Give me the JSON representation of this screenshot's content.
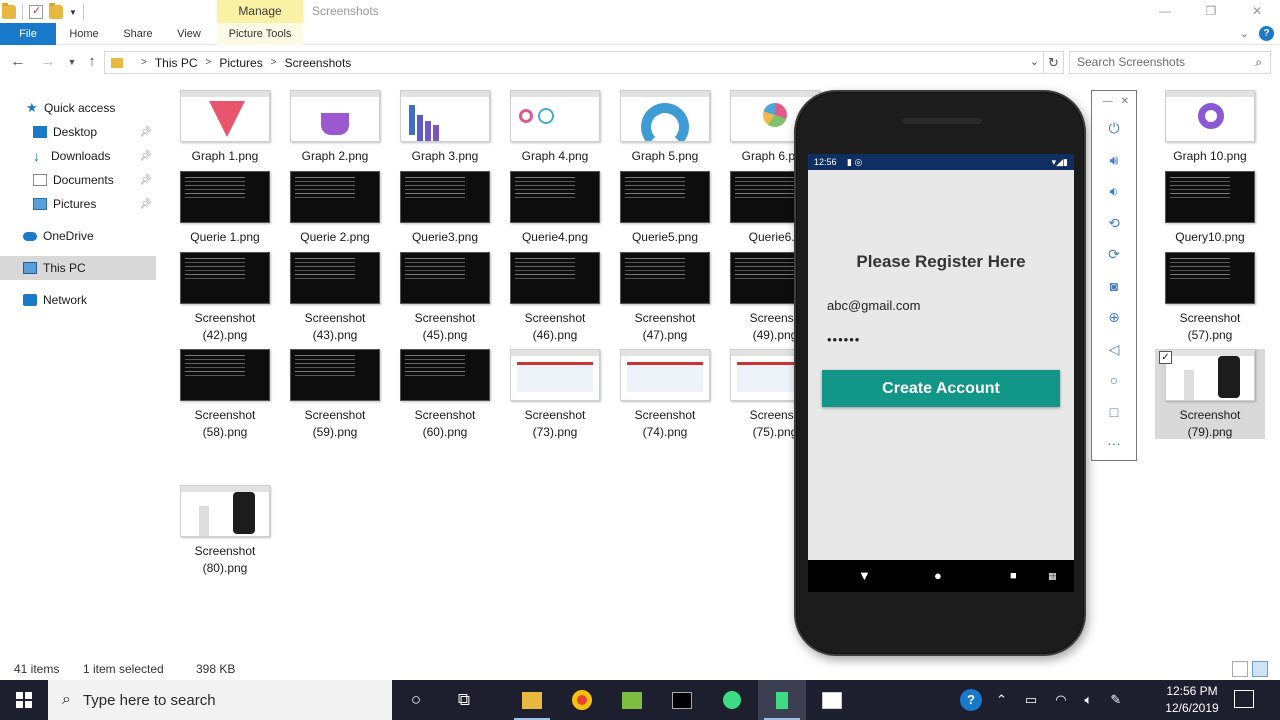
{
  "window": {
    "title": "Screenshots",
    "contextual_tab": "Manage",
    "controls": {
      "minimize": "—",
      "restore": "❐",
      "close": "✕"
    }
  },
  "ribbon": {
    "tabs": [
      "File",
      "Home",
      "Share",
      "View",
      "Picture Tools"
    ],
    "help": "?"
  },
  "address": {
    "breadcrumbs": [
      "This PC",
      "Pictures",
      "Screenshots"
    ],
    "search_placeholder": "Search Screenshots"
  },
  "nav": {
    "items": [
      "Quick access",
      "Desktop",
      "Downloads",
      "Documents",
      "Pictures",
      "OneDrive",
      "This PC",
      "Network"
    ],
    "selected": "This PC"
  },
  "files": [
    {
      "name": "Graph 1.png",
      "thumb": "funnel"
    },
    {
      "name": "Graph 2.png",
      "thumb": "cup"
    },
    {
      "name": "Graph 3.png",
      "thumb": "bars"
    },
    {
      "name": "Graph 4.png",
      "thumb": "rings"
    },
    {
      "name": "Graph 5.png",
      "thumb": "gauge"
    },
    {
      "name": "Graph 6.png",
      "thumb": "pie"
    },
    {
      "name": "Graph 10.png",
      "thumb": "donut"
    },
    {
      "name": "Querie 1.png",
      "thumb": "console"
    },
    {
      "name": "Querie 2.png",
      "thumb": "console"
    },
    {
      "name": "Querie3.png",
      "thumb": "console"
    },
    {
      "name": "Querie4.png",
      "thumb": "console"
    },
    {
      "name": "Querie5.png",
      "thumb": "console"
    },
    {
      "name": "Querie6.p",
      "thumb": "console"
    },
    {
      "name": "Query10.png",
      "thumb": "console"
    },
    {
      "name_l1": "Screenshot",
      "name_l2": "(42).png",
      "thumb": "console"
    },
    {
      "name_l1": "Screenshot",
      "name_l2": "(43).png",
      "thumb": "console"
    },
    {
      "name_l1": "Screenshot",
      "name_l2": "(45).png",
      "thumb": "console"
    },
    {
      "name_l1": "Screenshot",
      "name_l2": "(46).png",
      "thumb": "console"
    },
    {
      "name_l1": "Screenshot",
      "name_l2": "(47).png",
      "thumb": "console"
    },
    {
      "name_l1": "Screensh",
      "name_l2": "(49).png",
      "thumb": "console"
    },
    {
      "name_l1": "Screenshot",
      "name_l2": "(57).png",
      "thumb": "console"
    },
    {
      "name_l1": "Screenshot",
      "name_l2": "(58).png",
      "thumb": "console"
    },
    {
      "name_l1": "Screenshot",
      "name_l2": "(59).png",
      "thumb": "console"
    },
    {
      "name_l1": "Screenshot",
      "name_l2": "(60).png",
      "thumb": "console"
    },
    {
      "name_l1": "Screenshot",
      "name_l2": "(73).png",
      "thumb": "browser"
    },
    {
      "name_l1": "Screenshot",
      "name_l2": "(74).png",
      "thumb": "browser"
    },
    {
      "name_l1": "Screensh",
      "name_l2": "(75).png",
      "thumb": "browser"
    },
    {
      "name_l1": "Screenshot",
      "name_l2": "(79).png",
      "thumb": "phone",
      "selected": true
    },
    {
      "name_l1": "Screenshot",
      "name_l2": "(80).png",
      "thumb": "phone"
    }
  ],
  "status": {
    "items_count": "41 items",
    "selection": "1 item selected",
    "size": "398 KB"
  },
  "emulator": {
    "time": "12:56",
    "app_title": "Please Register Here",
    "email_value": "abc@gmail.com",
    "password_value": "••••••",
    "button_label": "Create Account",
    "button_color": "#119688",
    "tools": [
      "power-icon",
      "volume-up-icon",
      "volume-down-icon",
      "rotate-left-icon",
      "rotate-right-icon",
      "camera-icon",
      "zoom-icon",
      "back-icon",
      "home-icon",
      "overview-icon",
      "more-icon"
    ]
  },
  "taskbar": {
    "search_placeholder": "Type here to search",
    "time": "12:56 PM",
    "date": "12/6/2019"
  }
}
